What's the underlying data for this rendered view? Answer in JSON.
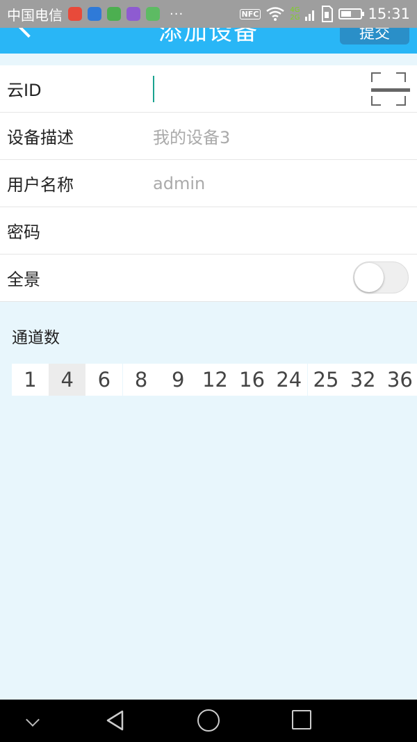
{
  "status_bar": {
    "carrier": "中国电信",
    "more": "···",
    "network_4g": "4G",
    "network_2g": "2G",
    "nfc": "NFC",
    "time": "15:31",
    "battery_level": 0.5,
    "app_icon_colors": [
      "#e84a3a",
      "#2f7ad8",
      "#4caf50",
      "#8e5bd1",
      "#5dbb63"
    ]
  },
  "app_bar": {
    "title": "添加设备",
    "submit_label": "提交",
    "background_color": "#29b6f6"
  },
  "form": {
    "cloud_id": {
      "label": "云ID",
      "value": ""
    },
    "device_desc": {
      "label": "设备描述",
      "placeholder": "我的设备3"
    },
    "username": {
      "label": "用户名称",
      "placeholder": "admin"
    },
    "password": {
      "label": "密码",
      "value": ""
    },
    "panorama": {
      "label": "全景",
      "enabled": false
    }
  },
  "channels": {
    "label": "通道数",
    "options": [
      "1",
      "4",
      "6",
      "8",
      "9",
      "12",
      "16",
      "24",
      "25",
      "32",
      "36"
    ],
    "selected": "4"
  }
}
